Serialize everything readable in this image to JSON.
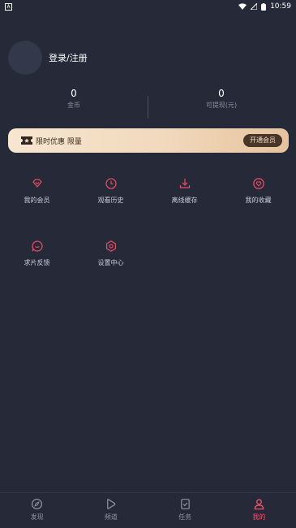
{
  "status_bar": {
    "app_badge": "A",
    "time": "10:59"
  },
  "profile": {
    "login_label": "登录/注册"
  },
  "stats": [
    {
      "value": "0",
      "label": "金币"
    },
    {
      "value": "0",
      "label": "可提现(元)"
    }
  ],
  "vip_banner": {
    "text": "限时优惠 限量",
    "button": "开通会员"
  },
  "grid": [
    {
      "label": "我的会员",
      "icon": "vip-heart-icon"
    },
    {
      "label": "观看历史",
      "icon": "clock-icon"
    },
    {
      "label": "离线缓存",
      "icon": "download-icon"
    },
    {
      "label": "我的收藏",
      "icon": "heart-icon"
    },
    {
      "label": "求片反馈",
      "icon": "chat-icon"
    },
    {
      "label": "设置中心",
      "icon": "settings-icon"
    }
  ],
  "bottom_nav": [
    {
      "label": "发现",
      "icon": "compass-icon",
      "active": false
    },
    {
      "label": "频道",
      "icon": "play-icon",
      "active": false
    },
    {
      "label": "任务",
      "icon": "task-icon",
      "active": false
    },
    {
      "label": "我的",
      "icon": "user-icon",
      "active": true
    }
  ],
  "colors": {
    "background": "#262a38",
    "accent": "#f2506e",
    "icon_red": "#e04a62",
    "vip_gold": "#f1d9bd"
  }
}
